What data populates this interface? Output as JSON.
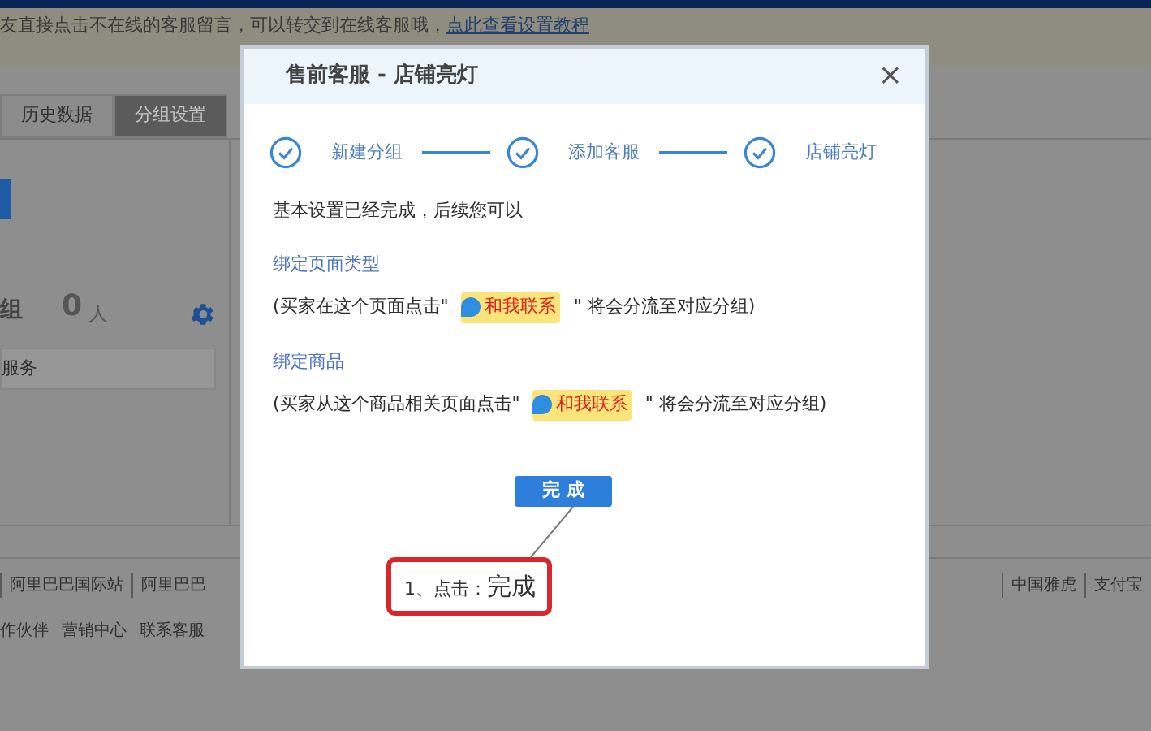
{
  "page": {
    "notice": {
      "text": "友直接点击不在线的客服留言，可以转交到在线客服哦，",
      "link": "点此查看设置教程"
    },
    "tabs": [
      {
        "label": "历史数据",
        "selected": false
      },
      {
        "label": "分组设置",
        "selected": true
      }
    ],
    "group": {
      "label": "组",
      "count": "0",
      "unit": "人"
    },
    "service_field": {
      "value": "服务"
    },
    "footer_links_left": [
      "阿里巴巴国际站",
      "阿里巴巴"
    ],
    "footer_links_right": [
      "中国雅虎",
      "支付宝"
    ],
    "bottom_links": [
      "作伙伴",
      "营销中心",
      "联系客服"
    ]
  },
  "dialog": {
    "title": "售前客服 - 店铺亮灯",
    "close": "×",
    "steps": [
      {
        "label": "新建分组",
        "done": true
      },
      {
        "label": "添加客服",
        "done": true
      },
      {
        "label": "店铺亮灯",
        "done": true
      }
    ],
    "intro": "基本设置已经完成，后续您可以",
    "sections": [
      {
        "link": "绑定页面类型",
        "before": "(买家在这个页面点击\"",
        "badge": "和我联系",
        "after": "\" 将会分流至对应分组)"
      },
      {
        "link": "绑定商品",
        "before": "(买家从这个商品相关页面点击\"",
        "badge": "和我联系",
        "after": "\" 将会分流至对应分组)"
      }
    ],
    "button": "完 成",
    "callout": {
      "prefix": "1、点击：",
      "emphasis": "完成"
    }
  }
}
